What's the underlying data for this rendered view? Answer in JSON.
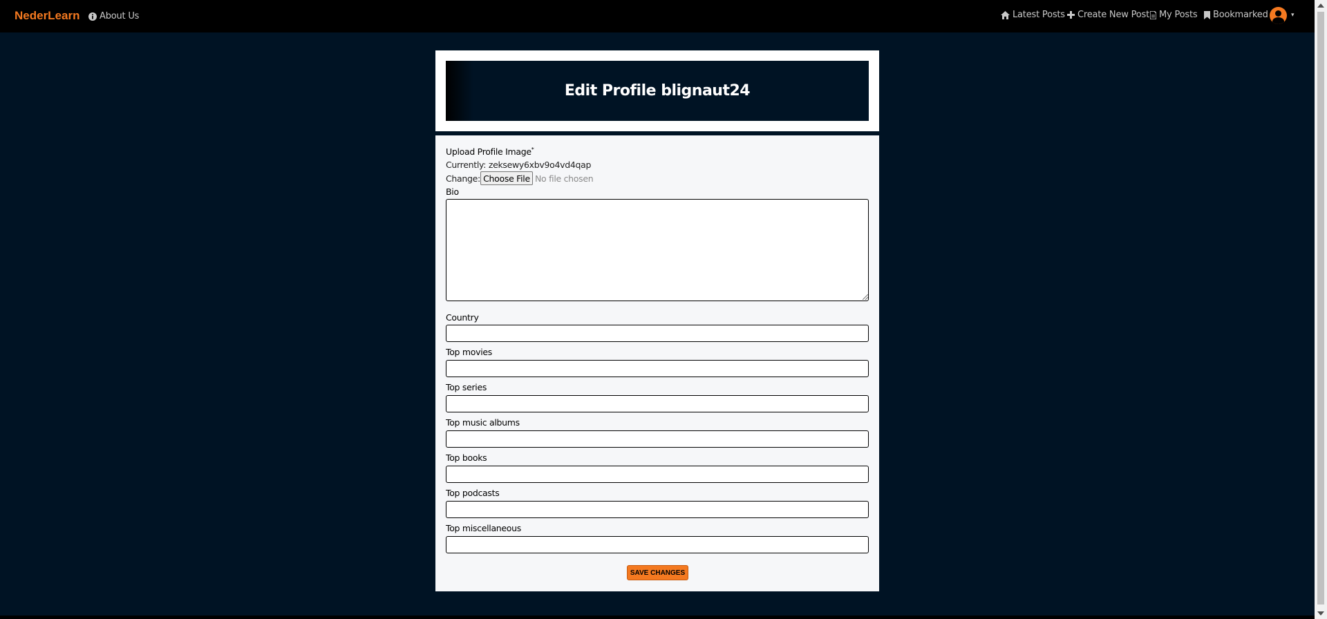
{
  "navbar": {
    "brand": "NederLearn",
    "about": "About Us",
    "latest": "Latest Posts",
    "create": "Create New Post",
    "my_posts": "My Posts",
    "bookmarked": "Bookmarked",
    "caret": "▾"
  },
  "header": {
    "title": "Edit Profile blignaut24"
  },
  "form": {
    "image_label": "Upload Profile Image",
    "image_required_mark": "*",
    "currently_label": "Currently:",
    "currently_value": "zeksewy6xbv9o4vd4qap",
    "change_label": "Change:",
    "choose_file": "Choose File",
    "no_file": "No file chosen",
    "bio_label": "Bio",
    "bio_value": "",
    "country_label": "Country",
    "movies_label": "Top movies",
    "series_label": "Top series",
    "albums_label": "Top music albums",
    "books_label": "Top books",
    "podcasts_label": "Top podcasts",
    "misc_label": "Top miscellaneous",
    "save_label": "Save Changes"
  },
  "colors": {
    "accent": "#f47920",
    "page_bg": "#001324",
    "navbar_bg": "#000000",
    "card_bg": "#f6f7f9"
  }
}
